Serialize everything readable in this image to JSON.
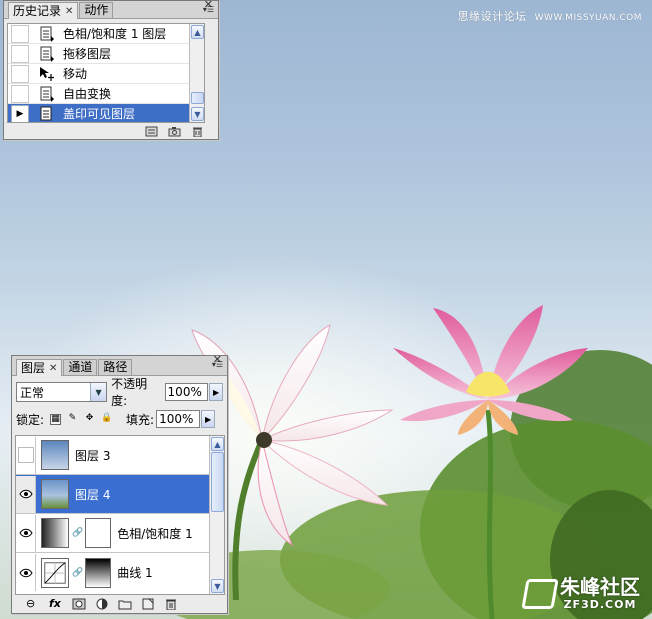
{
  "watermark": {
    "site_cn": "思缘设计论坛",
    "site_url": "WWW.MISSYUAN.COM"
  },
  "logo": {
    "name": "朱峰社区",
    "url": "ZF3D.COM"
  },
  "history_panel": {
    "tabs": [
      {
        "label": "历史记录",
        "active": true
      },
      {
        "label": "动作",
        "active": false
      }
    ],
    "items": [
      {
        "label": "色相/饱和度 1 图层",
        "icon": "layer-doc-icon",
        "selected": false
      },
      {
        "label": "拖移图层",
        "icon": "layer-doc-icon",
        "selected": false
      },
      {
        "label": "移动",
        "icon": "move-tool-icon",
        "selected": false
      },
      {
        "label": "自由变换",
        "icon": "layer-doc-icon",
        "selected": false
      },
      {
        "label": "盖印可见图层",
        "icon": "layer-doc-icon",
        "selected": true
      }
    ],
    "footer_icons": [
      "new-document-from-state-icon",
      "snapshot-camera-icon",
      "trash-icon"
    ]
  },
  "layers_panel": {
    "tabs": [
      {
        "label": "图层",
        "active": true
      },
      {
        "label": "通道",
        "active": false
      },
      {
        "label": "路径",
        "active": false
      }
    ],
    "blend_mode": "正常",
    "opacity_label": "不透明度:",
    "opacity_value": "100%",
    "lock_label": "锁定:",
    "fill_label": "填充:",
    "fill_value": "100%",
    "layers": [
      {
        "name": "图层 3",
        "visible": false,
        "selected": false,
        "has_mask": false,
        "thumb": "sky-photo"
      },
      {
        "name": "图层 4",
        "visible": true,
        "selected": true,
        "has_mask": false,
        "thumb": "lotus-photo"
      },
      {
        "name": "色相/饱和度 1",
        "visible": true,
        "selected": false,
        "has_mask": true,
        "thumb": "adjustment-hue"
      },
      {
        "name": "曲线 1",
        "visible": true,
        "selected": false,
        "has_mask": true,
        "thumb": "adjustment-curves"
      }
    ],
    "footer_icons": [
      "link-icon",
      "fx-icon",
      "mask-icon",
      "adjustment-icon",
      "group-folder-icon",
      "new-layer-icon",
      "trash-icon"
    ],
    "fx_label": "fx"
  },
  "colors": {
    "selection_blue": "#3a6ed0",
    "panel_gray": "#ebebeb"
  }
}
